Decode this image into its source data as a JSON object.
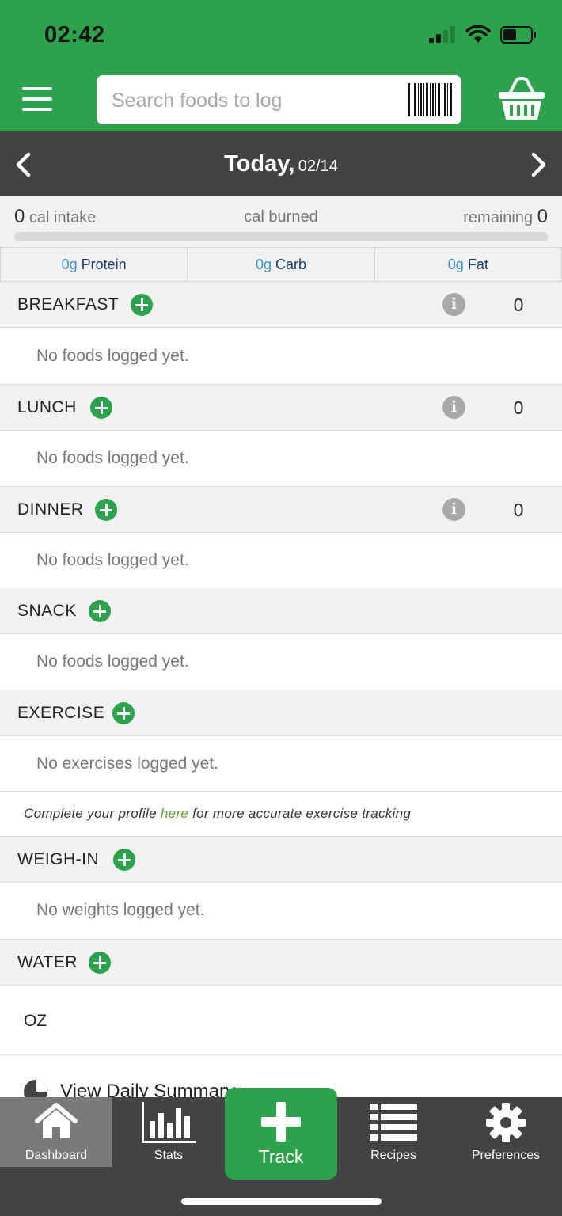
{
  "status_bar": {
    "time": "02:42"
  },
  "header": {
    "search_placeholder": "Search foods to log"
  },
  "date_bar": {
    "day": "Today,",
    "date": "02/14"
  },
  "calories": {
    "intake_value": "0",
    "intake_label": "cal intake",
    "burned_label": "cal burned",
    "remaining_label": "remaining",
    "remaining_value": "0"
  },
  "macros": [
    {
      "amount": "0g",
      "name": "Protein"
    },
    {
      "amount": "0g",
      "name": "Carb"
    },
    {
      "amount": "0g",
      "name": "Fat"
    }
  ],
  "sections": {
    "breakfast": {
      "title": "BREAKFAST",
      "calories": "0",
      "empty": "No foods logged yet."
    },
    "lunch": {
      "title": "LUNCH",
      "calories": "0",
      "empty": "No foods logged yet."
    },
    "dinner": {
      "title": "DINNER",
      "calories": "0",
      "empty": "No foods logged yet."
    },
    "snack": {
      "title": "SNACK",
      "empty": "No foods logged yet."
    },
    "exercise": {
      "title": "EXERCISE",
      "empty": "No exercises logged yet."
    },
    "weigh_in": {
      "title": "WEIGH-IN",
      "empty": "No weights logged yet."
    },
    "water": {
      "title": "WATER",
      "unit": "OZ"
    }
  },
  "profile_note": {
    "before": "Complete your profile ",
    "link": "here",
    "after": " for more accurate exercise tracking"
  },
  "summary_link": "View Daily Summary",
  "tabs": {
    "dashboard": "Dashboard",
    "stats": "Stats",
    "track": "Track",
    "recipes": "Recipes",
    "preferences": "Preferences"
  },
  "colors": {
    "brand_green": "#2ba24c",
    "dark_bar": "#434343",
    "macro_blue": "#3b8fd6",
    "link_green": "#5aa52c"
  }
}
